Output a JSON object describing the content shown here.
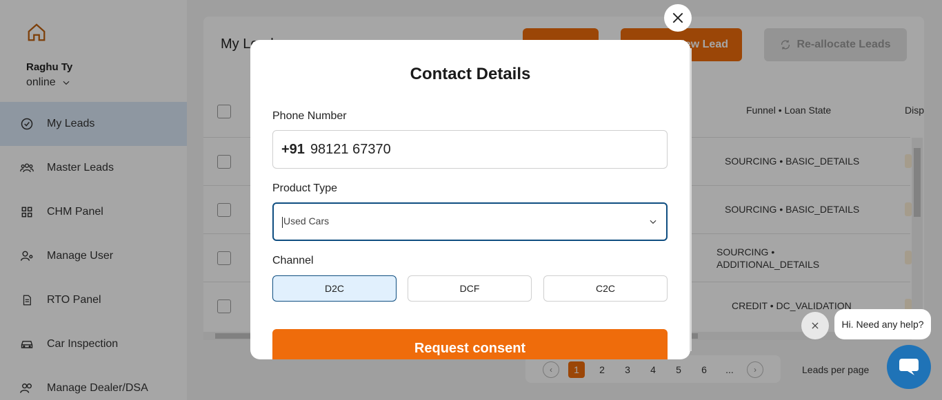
{
  "sidebar": {
    "user_name": "Raghu Ty",
    "status": "online",
    "items": [
      {
        "label": "My Leads",
        "icon": "check-circle-icon"
      },
      {
        "label": "Master Leads",
        "icon": "users-icon"
      },
      {
        "label": "CHM Panel",
        "icon": "grid-icon"
      },
      {
        "label": "Manage User",
        "icon": "user-gear-icon"
      },
      {
        "label": "RTO Panel",
        "icon": "document-icon"
      },
      {
        "label": "Car Inspection",
        "icon": "car-icon"
      },
      {
        "label": "Manage Dealer/DSA",
        "icon": "people-icon"
      }
    ]
  },
  "main": {
    "title": "My Leads",
    "new_lead_label": "New Lead",
    "reallocate_label": "Re-allocate Leads",
    "headers": {
      "funnel": "Funnel • Loan State",
      "disp": "Disp"
    },
    "rows": [
      {
        "funnel": "SOURCING • BASIC_DETAILS"
      },
      {
        "funnel": "SOURCING • BASIC_DETAILS"
      },
      {
        "funnel": "SOURCING •\nADDITIONAL_DETAILS"
      },
      {
        "funnel": "CREDIT • DC_VALIDATION"
      }
    ]
  },
  "pagination": {
    "pages": [
      "1",
      "2",
      "3",
      "4",
      "5",
      "6",
      "..."
    ],
    "current": "1",
    "per_page_label": "Leads per page"
  },
  "modal": {
    "title": "Contact Details",
    "phone_label": "Phone Number",
    "phone_prefix": "+91",
    "phone_value": "98121 67370",
    "product_label": "Product Type",
    "product_value": "Used Cars",
    "channel_label": "Channel",
    "channels": [
      "D2C",
      "DCF",
      "C2C"
    ],
    "selected_channel": "D2C",
    "submit_label": "Request consent"
  },
  "chat": {
    "bubble_text": "Hi. Need any help?"
  },
  "colors": {
    "accent": "#ef6c0b",
    "focus": "#0e4d80",
    "selected_bg": "#e1f0fd",
    "chat": "#1f73b7"
  }
}
